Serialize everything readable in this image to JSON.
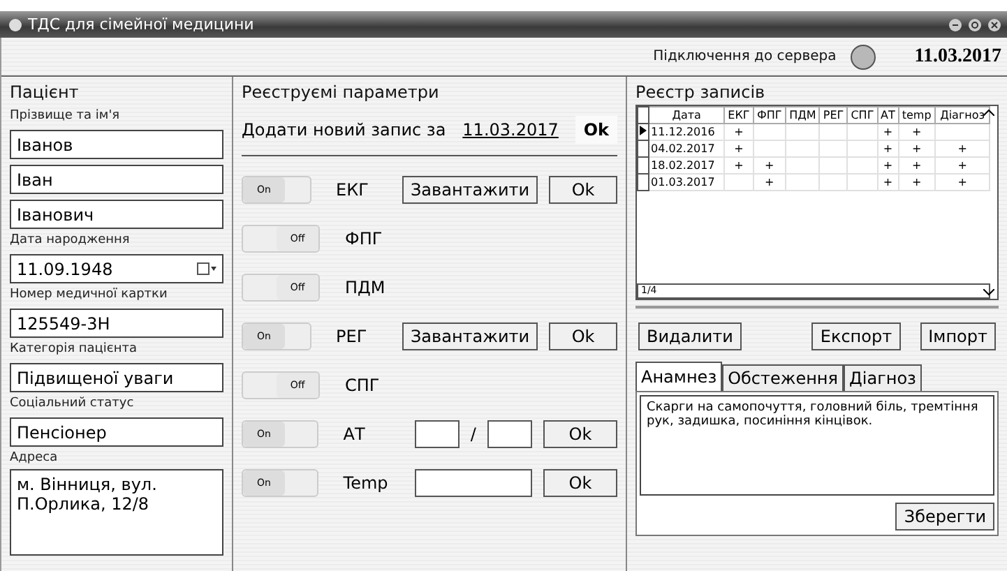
{
  "window": {
    "title": "ТДС для сімейної медицини"
  },
  "header": {
    "connection_label": "Підключення до сервера",
    "connected": false,
    "date": "11.03.2017"
  },
  "patient": {
    "title": "Пацієнт",
    "fields": [
      {
        "label": "Прізвище та ім'я",
        "value": "Іванов",
        "kind": "text"
      },
      {
        "value": "Іван",
        "kind": "text"
      },
      {
        "value": "Іванович",
        "kind": "text"
      },
      {
        "label": "Дата народження",
        "value": "11.09.1948",
        "kind": "date"
      },
      {
        "label": "Номер медичної картки",
        "value": "125549-3Н",
        "kind": "text"
      },
      {
        "label": "Категорія пацієнта",
        "value": "Підвищеної уваги",
        "kind": "text"
      },
      {
        "label": "Соціальний статус",
        "value": "Пенсіонер",
        "kind": "text"
      },
      {
        "label": "Адреса",
        "value": "м. Вінниця, вул. П.Орлика, 12/8",
        "kind": "area"
      }
    ]
  },
  "parameters": {
    "title": "Реєструємі параметри",
    "add_label": "Додати новий запис за",
    "add_date": "11.03.2017",
    "add_button": "Ok",
    "items": [
      {
        "name": "ЕКГ",
        "on": true,
        "switch_label": "On",
        "kind": "upload",
        "upload": "Завантажити",
        "ok": "Ok"
      },
      {
        "name": "ФПГ",
        "on": false,
        "switch_label": "Off",
        "kind": "plain"
      },
      {
        "name": "ПДМ",
        "on": false,
        "switch_label": "Off",
        "kind": "plain"
      },
      {
        "name": "РЕГ",
        "on": true,
        "switch_label": "On",
        "kind": "upload",
        "upload": "Завантажити",
        "ok": "Ok"
      },
      {
        "name": "СПГ",
        "on": false,
        "switch_label": "Off",
        "kind": "plain"
      },
      {
        "name": "АТ",
        "on": true,
        "switch_label": "On",
        "kind": "pressure",
        "separator": "/",
        "ok": "Ok"
      },
      {
        "name": "Temp",
        "on": true,
        "switch_label": "On",
        "kind": "value",
        "ok": "Ok"
      }
    ]
  },
  "registry": {
    "title": "Реєстр записів",
    "columns": [
      "Дата",
      "ЕКГ",
      "ФПГ",
      "ПДМ",
      "РЕГ",
      "СПГ",
      "АТ",
      "temp",
      "Діагноз"
    ],
    "rows": [
      {
        "selected": true,
        "cells": [
          "11.12.2016",
          "+",
          null,
          null,
          null,
          null,
          "+",
          "+",
          null
        ]
      },
      {
        "selected": false,
        "cells": [
          "04.02.2017",
          "+",
          null,
          null,
          null,
          null,
          "+",
          "+",
          "+"
        ]
      },
      {
        "selected": false,
        "cells": [
          "18.02.2017",
          "+",
          "+",
          null,
          null,
          null,
          "+",
          "+",
          "+"
        ]
      },
      {
        "selected": false,
        "cells": [
          "01.03.2017",
          null,
          "+",
          null,
          null,
          null,
          "+",
          "+",
          "+"
        ]
      }
    ],
    "pager": "1/4",
    "buttons": [
      "Видалити",
      "Експорт",
      "Імпорт"
    ]
  },
  "notes": {
    "tabs": [
      {
        "label": "Анамнез",
        "selected": true
      },
      {
        "label": "Обстеження",
        "selected": false
      },
      {
        "label": "Діагноз",
        "selected": false
      }
    ],
    "text": "Скарги на самопочуття, головний біль, тремтіння рук, задишка, посиніння кінцівок.",
    "save": "Зберегти"
  }
}
